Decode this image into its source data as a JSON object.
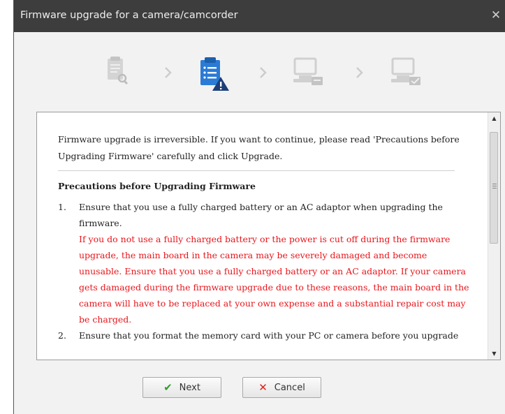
{
  "window": {
    "title": "Firmware upgrade for a camera/camcorder",
    "close_glyph": "✕"
  },
  "steps": [
    {
      "icon": "document-search-icon",
      "state": "inactive"
    },
    {
      "icon": "document-warning-icon",
      "state": "active"
    },
    {
      "icon": "computer-transfer-icon",
      "state": "inactive"
    },
    {
      "icon": "computer-check-icon",
      "state": "inactive"
    }
  ],
  "step_arrow": "›",
  "content": {
    "intro": "Firmware upgrade is irreversible. If you want to continue, please read 'Precautions before Upgrading Firmware' carefully and click Upgrade.",
    "precautions_title": "Precautions before Upgrading Firmware",
    "items": [
      {
        "number": "1.",
        "text": "Ensure that you use a fully charged battery or an AC adaptor when upgrading the firmware.",
        "warning": "If you do not use a fully charged battery or the power is cut off during the firmware upgrade, the main board in the camera may be severely damaged and become unusable. Ensure that you use a fully charged battery or an AC adaptor. If your camera gets damaged during the firmware upgrade due to these reasons, the main board in the camera will have to be replaced at your own expense and a substantial repair cost may be charged."
      },
      {
        "number": "2.",
        "text": "Ensure that you format the memory card with your PC or camera before you upgrade"
      }
    ]
  },
  "buttons": {
    "next": "Next",
    "cancel": "Cancel"
  },
  "colors": {
    "accent": "#2a7bd5",
    "warning_text": "#e8151b",
    "inactive_icon": "#cfcfcf"
  }
}
